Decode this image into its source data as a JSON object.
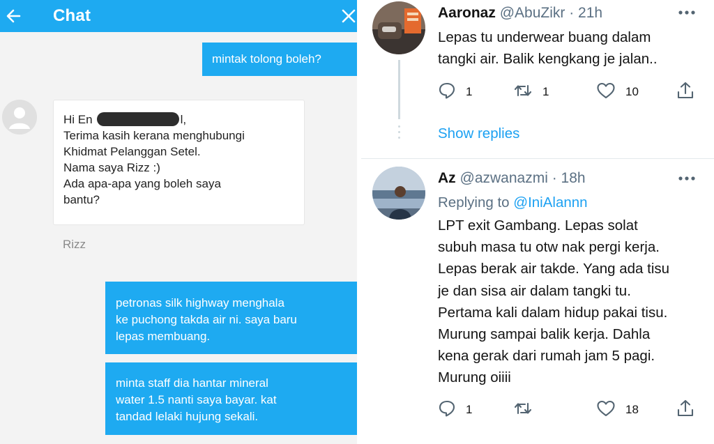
{
  "chat": {
    "title": "Chat",
    "messages": {
      "m1": "mintak tolong boleh?",
      "greeting_prefix": "Hi En",
      "greeting_suffix": "l,",
      "m2_lines": [
        "Terima kasih kerana menghubungi",
        "Khidmat Pelanggan Setel.",
        "Nama saya Rizz :)",
        "Ada apa-apa yang boleh saya",
        "bantu?"
      ],
      "agent_name": "Rizz",
      "m3_lines": [
        "petronas silk highway menghala",
        "ke puchong takda air ni. saya baru",
        "lepas membuang."
      ],
      "m4_lines": [
        "minta staff dia hantar mineral",
        "water 1.5 nanti saya bayar. kat",
        "tandad lelaki hujung sekali."
      ]
    },
    "colors": {
      "header": "#1eaaf1",
      "outgoing_bubble": "#1eaaf1",
      "background": "#f3f3f3"
    },
    "icons": {
      "back": "arrow-left-icon",
      "close": "close-icon",
      "avatar": "user-avatar-icon"
    }
  },
  "tweets": [
    {
      "name": "Aaronaz",
      "handle": "@AbuZikr",
      "time": "21h",
      "text_lines": [
        "Lepas tu underwear buang dalam",
        "tangki air. Balik kengkang je jalan.."
      ],
      "replies": "1",
      "retweets": "1",
      "likes": "10",
      "show_replies": "Show replies"
    },
    {
      "name": "Az",
      "handle": "@azwanazmi",
      "time": "18h",
      "replying_to_label": "Replying to",
      "replying_to_handle": "@IniAlannn",
      "text_lines": [
        "LPT exit Gambang. Lepas solat",
        "subuh masa tu otw nak pergi kerja.",
        "Lepas berak air takde. Yang ada tisu",
        "je dan sisa air dalam tangki tu.",
        "Pertama kali dalam hidup pakai tisu.",
        "Murung sampai balik kerja. Dahla",
        "kena gerak dari rumah jam 5 pagi.",
        "Murung oiiii"
      ],
      "replies": "1",
      "retweets": "",
      "likes": "18"
    }
  ],
  "tweet_colors": {
    "link": "#1da1f2",
    "meta": "#5b7083",
    "icon": "#536471"
  },
  "tweet_icons": [
    "reply-icon",
    "retweet-icon",
    "like-icon",
    "share-icon",
    "more-icon"
  ]
}
